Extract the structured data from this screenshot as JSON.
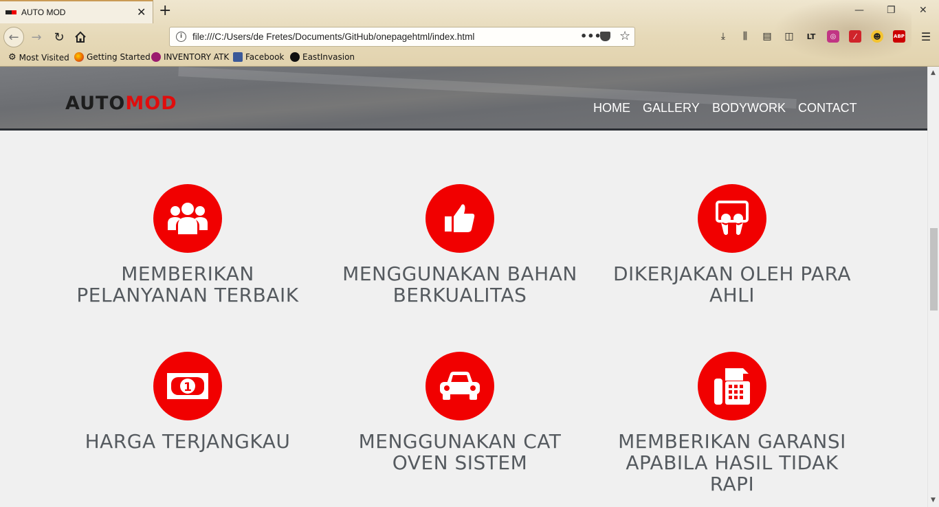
{
  "browser": {
    "tab_title": "AUTO MOD",
    "url": "file:///C:/Users/de Fretes/Documents/GitHub/onepagehtml/index.html",
    "page_actions": "•••",
    "bookmarks": [
      {
        "label": "Most Visited"
      },
      {
        "label": "Getting Started"
      },
      {
        "label": "INVENTORY ATK"
      },
      {
        "label": "Facebook"
      },
      {
        "label": "EastInvasion"
      }
    ]
  },
  "site": {
    "logo": {
      "part1": "AUTO",
      "part2": "MOD"
    },
    "nav": [
      "HOME",
      "GALLERY",
      "BODYWORK",
      "CONTACT"
    ],
    "features": [
      {
        "icon": "users-icon",
        "title": "MEMBERIKAN PELANYANAN TERBAIK"
      },
      {
        "icon": "thumbs-up-icon",
        "title": "MENGGUNAKAN BAHAN BERKUALITAS"
      },
      {
        "icon": "slideshare-icon",
        "title": "DIKERJAKAN OLEH PARA AHLI"
      },
      {
        "icon": "money-icon",
        "title": "HARGA TERJANGKAU"
      },
      {
        "icon": "car-icon",
        "title": "MENGGUNAKAN CAT OVEN SISTEM"
      },
      {
        "icon": "fax-icon",
        "title": "MEMBERIKAN GARANSI APABILA HASIL TIDAK RAPI"
      }
    ]
  },
  "colors": {
    "accent_red": "#f10000",
    "logo_red": "#e00d0d",
    "heading_gray": "#555a5f",
    "header_bg": "#6c6e72"
  }
}
